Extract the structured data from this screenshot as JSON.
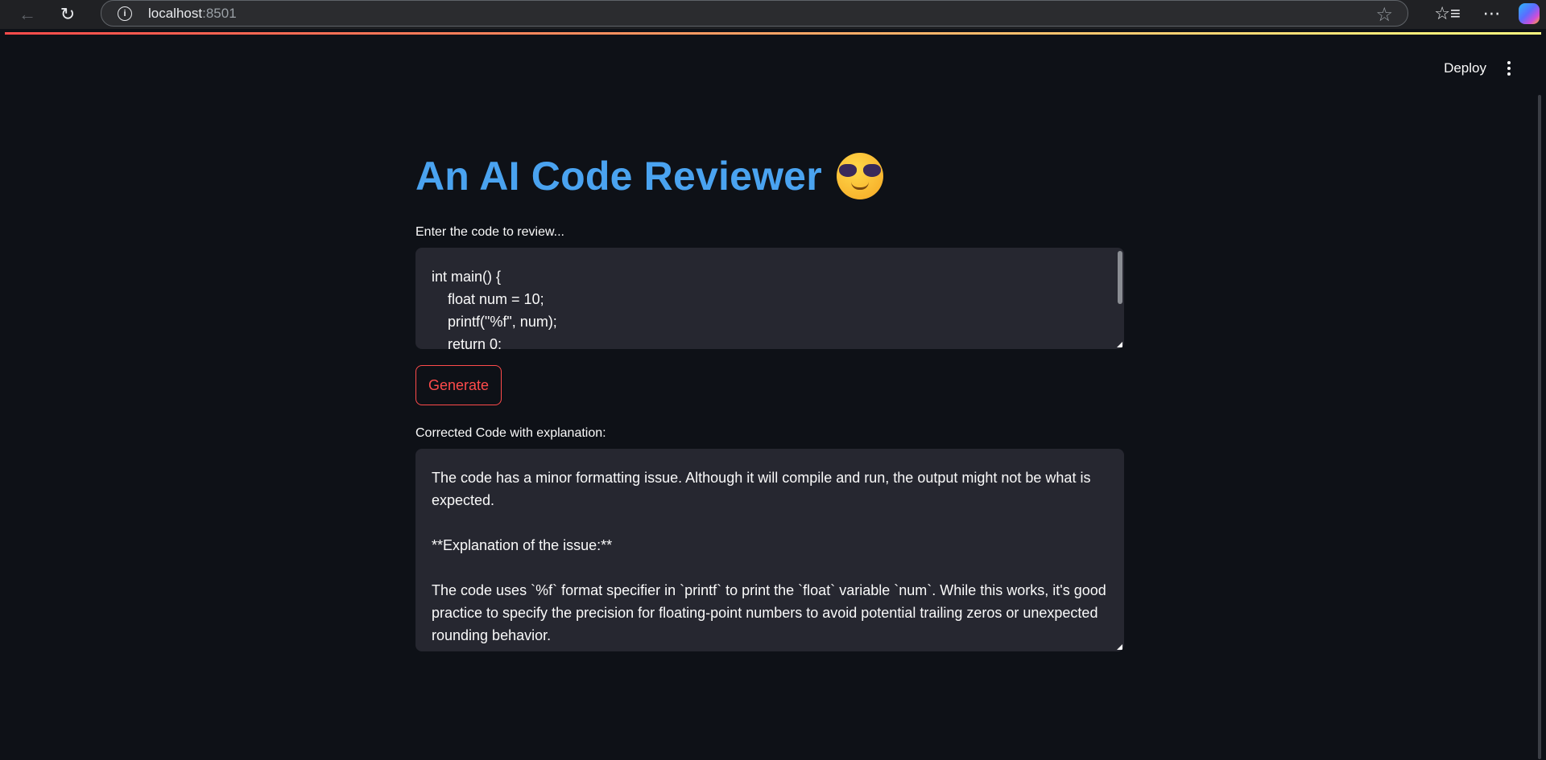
{
  "browser": {
    "url_host": "localhost",
    "url_port": ":8501"
  },
  "header": {
    "deploy_label": "Deploy"
  },
  "main": {
    "title": "An AI Code Reviewer",
    "input_label": "Enter the code to review...",
    "code_lines": [
      "int main() {",
      "    float num = 10;",
      "    printf(\"%f\", num);",
      "    return 0;"
    ],
    "generate_label": "Generate",
    "output_label": "Corrected Code with explanation:",
    "output_paragraphs": [
      "The code has a minor formatting issue. Although it will compile and run, the output might not be what is expected.",
      "**Explanation of the issue:**",
      "The code uses `%f` format specifier in `printf` to print the `float` variable `num`. While this works,  it's good practice to specify the precision for floating-point numbers to avoid potential trailing zeros or unexpected rounding behavior."
    ]
  },
  "colors": {
    "background": "#0e1117",
    "title": "#4aa3f0",
    "accent": "#ff4b4b",
    "input_bg": "#262730"
  }
}
